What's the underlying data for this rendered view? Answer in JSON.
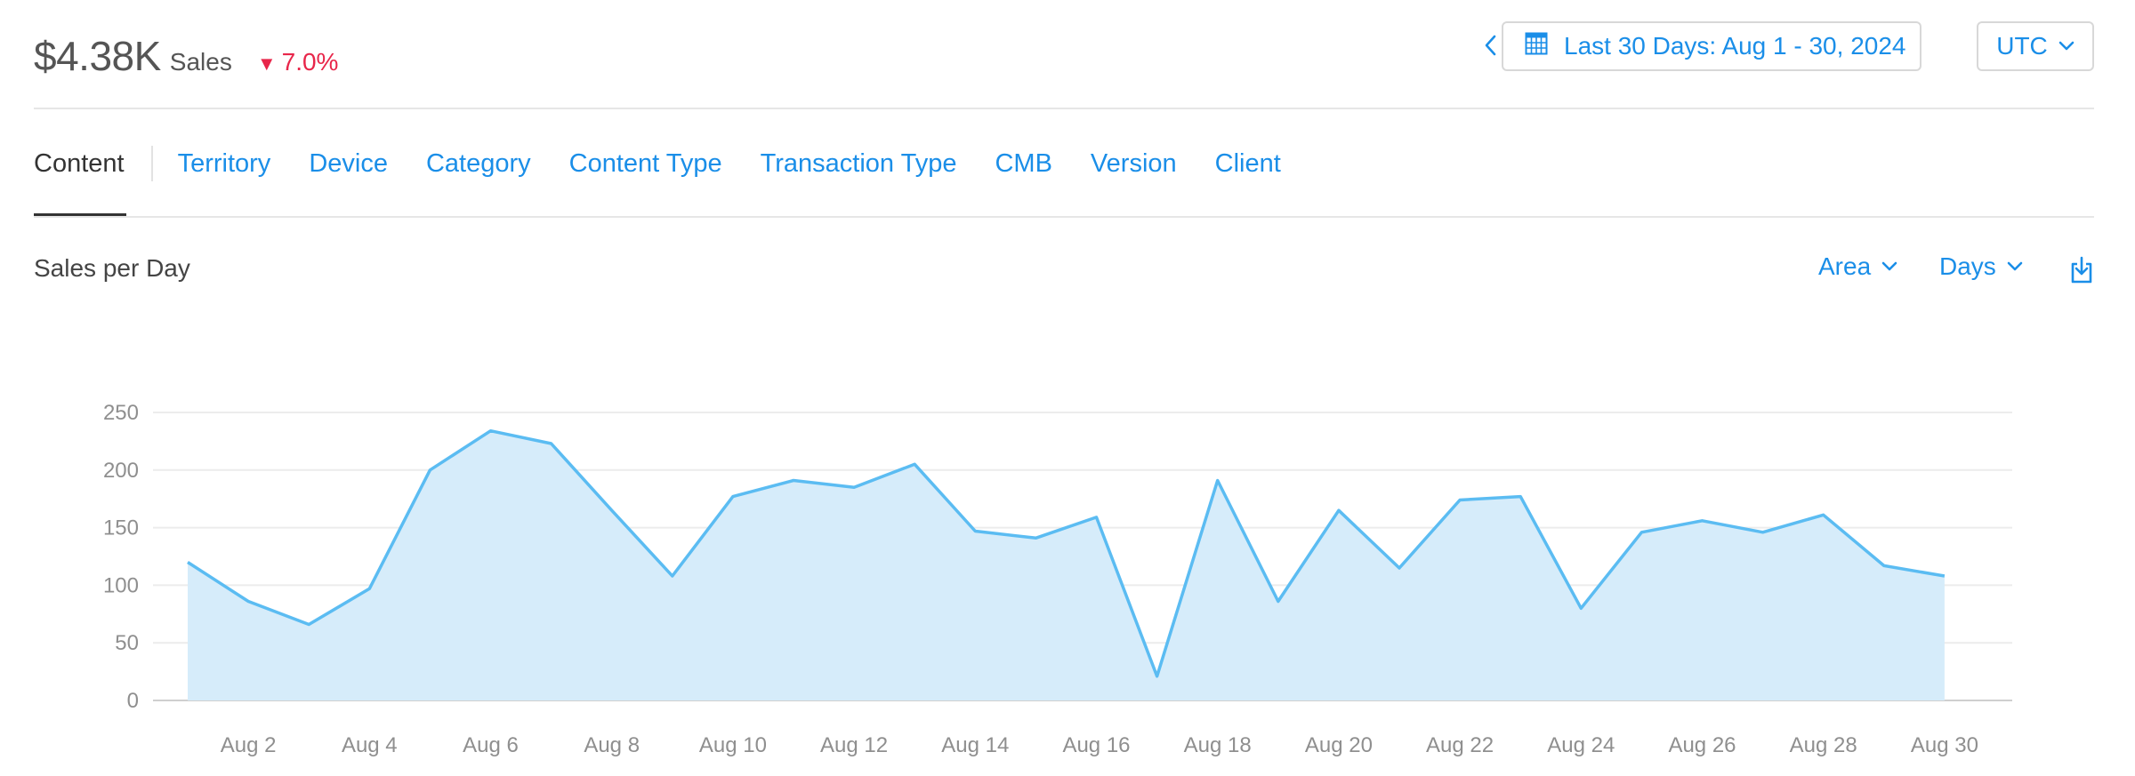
{
  "colors": {
    "accent": "#1a8ee8",
    "negative": "#e8264a",
    "series_line": "#5bbcf2",
    "series_fill": "#d6ecfa"
  },
  "summary": {
    "total": "$4.38K",
    "label": "Sales",
    "change": "7.0%",
    "change_direction": "down"
  },
  "date_range": {
    "label": "Last 30 Days: Aug 1 - 30, 2024",
    "icon": "calendar-icon"
  },
  "timezone": {
    "label": "UTC"
  },
  "tabs": [
    {
      "label": "Content",
      "active": true
    },
    {
      "label": "Territory"
    },
    {
      "label": "Device"
    },
    {
      "label": "Category"
    },
    {
      "label": "Content Type"
    },
    {
      "label": "Transaction Type"
    },
    {
      "label": "CMB"
    },
    {
      "label": "Version"
    },
    {
      "label": "Client"
    }
  ],
  "section": {
    "title": "Sales per Day"
  },
  "controls": {
    "chart_type": "Area",
    "granularity": "Days",
    "download_icon": "download-icon"
  },
  "chart_data": {
    "type": "area",
    "x": [
      "Aug 1",
      "Aug 2",
      "Aug 3",
      "Aug 4",
      "Aug 5",
      "Aug 6",
      "Aug 7",
      "Aug 8",
      "Aug 9",
      "Aug 10",
      "Aug 11",
      "Aug 12",
      "Aug 13",
      "Aug 14",
      "Aug 15",
      "Aug 16",
      "Aug 17",
      "Aug 18",
      "Aug 19",
      "Aug 20",
      "Aug 21",
      "Aug 22",
      "Aug 23",
      "Aug 24",
      "Aug 25",
      "Aug 26",
      "Aug 27",
      "Aug 28",
      "Aug 29",
      "Aug 30"
    ],
    "x_tick_labels": [
      "Aug 2",
      "Aug 4",
      "Aug 6",
      "Aug 8",
      "Aug 10",
      "Aug 12",
      "Aug 14",
      "Aug 16",
      "Aug 18",
      "Aug 20",
      "Aug 22",
      "Aug 24",
      "Aug 26",
      "Aug 28",
      "Aug 30"
    ],
    "series": [
      {
        "values": [
          120,
          86,
          66,
          97,
          200,
          234,
          223,
          165,
          108,
          177,
          191,
          185,
          205,
          147,
          141,
          159,
          21,
          191,
          86,
          165,
          115,
          174,
          177,
          80,
          146,
          156,
          146,
          161,
          117,
          108
        ]
      }
    ],
    "y_ticks": [
      0,
      50,
      100,
      150,
      200,
      250
    ],
    "ylim": [
      0,
      250
    ],
    "grid": true,
    "legend": "none"
  }
}
